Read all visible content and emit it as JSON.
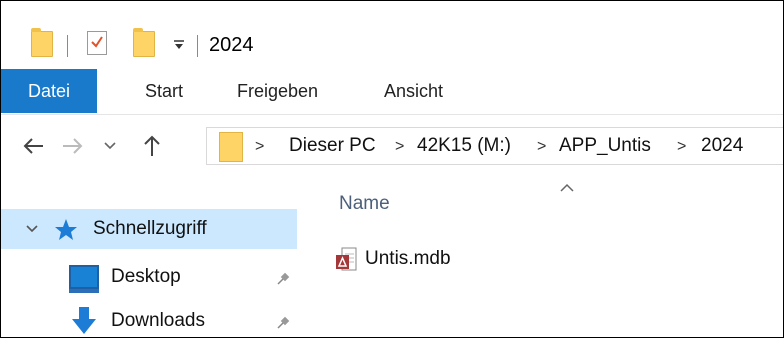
{
  "window": {
    "title": "2024"
  },
  "ribbon": {
    "tabs": [
      {
        "label": "Datei",
        "active": true
      },
      {
        "label": "Start"
      },
      {
        "label": "Freigeben"
      },
      {
        "label": "Ansicht"
      }
    ]
  },
  "address": {
    "crumbs": [
      "Dieser PC",
      "42K15 (M:)",
      "APP_Untis",
      "2024"
    ],
    "separator": ">"
  },
  "navpane": {
    "items": [
      {
        "label": "Schnellzugriff",
        "icon": "star-icon",
        "selected": true
      },
      {
        "label": "Desktop",
        "icon": "desktop-icon",
        "pinned": true
      },
      {
        "label": "Downloads",
        "icon": "download-icon",
        "pinned": true
      }
    ]
  },
  "content": {
    "column_header": "Name",
    "files": [
      {
        "name": "Untis.mdb",
        "icon": "access-db-file-icon"
      }
    ]
  },
  "colors": {
    "file_tab": "#1979ca",
    "selected_row": "#cce8ff",
    "folder": "#ffd467",
    "column_header_text": "#4c607a"
  }
}
